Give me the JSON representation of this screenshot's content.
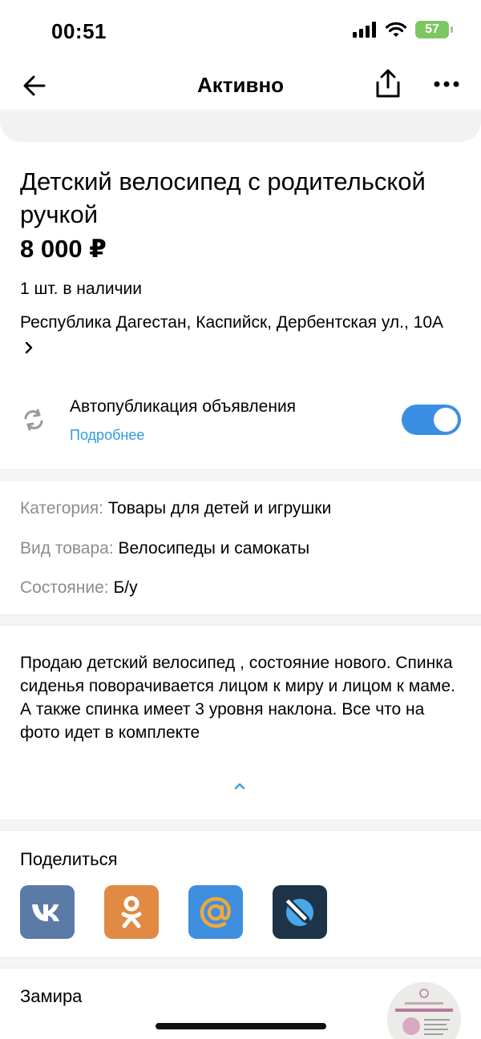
{
  "status_bar": {
    "time": "00:51",
    "battery": "57"
  },
  "nav": {
    "title": "Активно"
  },
  "listing": {
    "title": "Детский велосипед с родительской ручкой",
    "price": "8 000 ₽",
    "stock": "1 шт. в наличии",
    "address": "Республика Дагестан, Каспийск, Дербентская ул., 10А"
  },
  "autopublish": {
    "label": "Автопубликация объявления",
    "link": "Подробнее",
    "enabled": true
  },
  "params": [
    {
      "key": "Категория:",
      "value": "Товары для детей и игрушки"
    },
    {
      "key": "Вид товара:",
      "value": "Велосипеды и самокаты"
    },
    {
      "key": "Состояние:",
      "value": "Б/у"
    }
  ],
  "description": "Продаю детский велосипед , состояние нового. Спинка сиденья поворачивается лицом к миру и лицом к маме. А также спинка имеет 3 уровня наклона. Все что на фото идет в комплекте",
  "share": {
    "title": "Поделиться",
    "buttons": [
      {
        "icon": "vk-icon",
        "color": "#5b7aa8"
      },
      {
        "icon": "odnoklassniki-icon",
        "color": "#e08a44"
      },
      {
        "icon": "mail-ru-icon",
        "color": "#3f8ee0"
      },
      {
        "icon": "livejournal-icon",
        "color": "#1d3448"
      }
    ]
  },
  "seller": {
    "name": "Замира"
  },
  "colors": {
    "accent": "#3a8fe5",
    "link": "#2b9be0",
    "muted": "#8c8c8c"
  }
}
